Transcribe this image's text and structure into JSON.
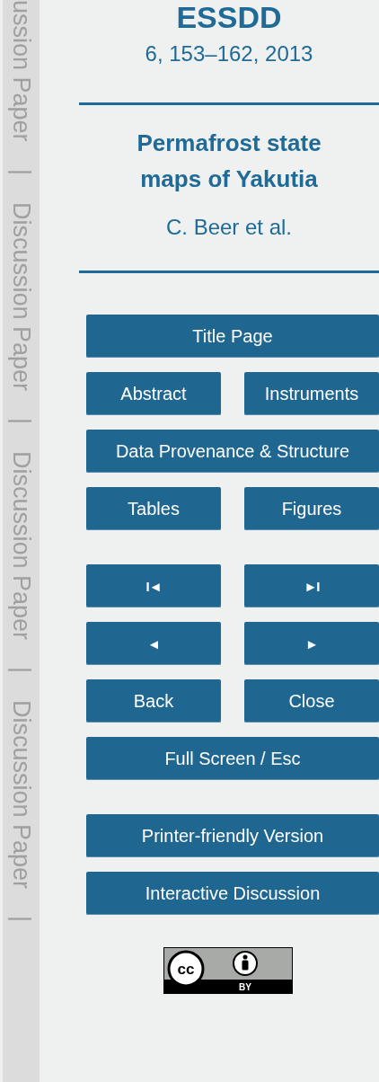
{
  "side_strip": [
    "ussion Paper",
    "|",
    "Discussion Paper",
    "|",
    "Discussion Paper",
    "|",
    "Discussion Paper",
    "|"
  ],
  "journal": "ESSDD",
  "citation": "6, 153–162, 2013",
  "title": "Permafrost state maps of Yakutia",
  "authors": "C. Beer et al.",
  "button_groups": [
    {
      "rows": [
        [
          {
            "label": "Title Page"
          }
        ],
        [
          {
            "label": "Abstract"
          },
          {
            "label": "Instruments"
          }
        ],
        [
          {
            "label": "Data Provenance & Structure"
          }
        ],
        [
          {
            "label": "Tables"
          },
          {
            "label": "Figures"
          }
        ]
      ]
    },
    {
      "rows": [
        [
          {
            "label": "I◄",
            "kind": "glyph"
          },
          {
            "label": "►I",
            "kind": "glyph"
          }
        ],
        [
          {
            "label": "◄",
            "kind": "glyph"
          },
          {
            "label": "►",
            "kind": "glyph"
          }
        ],
        [
          {
            "label": "Back"
          },
          {
            "label": "Close"
          }
        ],
        [
          {
            "label": "Full Screen / Esc"
          }
        ]
      ]
    },
    {
      "rows": [
        [
          {
            "label": "Printer-friendly Version"
          }
        ],
        [
          {
            "label": "Interactive Discussion"
          }
        ]
      ]
    }
  ],
  "license": {
    "mark": "cc",
    "label": "BY"
  }
}
